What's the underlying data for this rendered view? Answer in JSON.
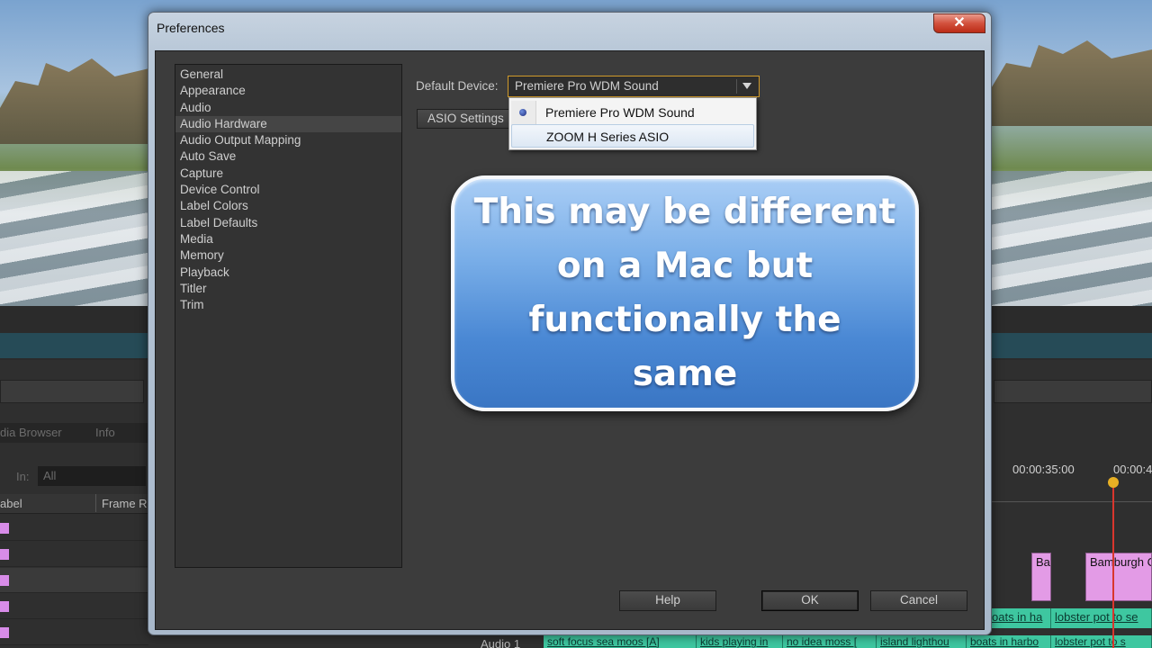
{
  "background_app": {
    "panel_tabs": [
      "dia Browser",
      "Info"
    ],
    "in_label": "In:",
    "in_value": "All",
    "column_headers": [
      "abel",
      "Frame R"
    ],
    "timecodes": [
      "00:00:35:00",
      "00:00:4"
    ],
    "video_clips": [
      "Ba",
      "Bamburgh C"
    ],
    "audio_track_label": "Audio 1",
    "audio_clips_row1": [
      "oats in ha",
      "lobster pot to se"
    ],
    "audio_clips_row2": [
      "soft focus sea moos [A]",
      "kids playing in",
      "no idea moss [",
      "island lighthou",
      "boats in harbo",
      "lobster pot to s"
    ]
  },
  "dialog": {
    "title": "Preferences",
    "close_label": "✕",
    "sidebar": {
      "items": [
        {
          "label": "General",
          "selected": false
        },
        {
          "label": "Appearance",
          "selected": false
        },
        {
          "label": "Audio",
          "selected": false
        },
        {
          "label": "Audio Hardware",
          "selected": true
        },
        {
          "label": "Audio Output Mapping",
          "selected": false
        },
        {
          "label": "Auto Save",
          "selected": false
        },
        {
          "label": "Capture",
          "selected": false
        },
        {
          "label": "Device Control",
          "selected": false
        },
        {
          "label": "Label Colors",
          "selected": false
        },
        {
          "label": "Label Defaults",
          "selected": false
        },
        {
          "label": "Media",
          "selected": false
        },
        {
          "label": "Memory",
          "selected": false
        },
        {
          "label": "Playback",
          "selected": false
        },
        {
          "label": "Titler",
          "selected": false
        },
        {
          "label": "Trim",
          "selected": false
        }
      ]
    },
    "default_device": {
      "label": "Default Device:",
      "selected_value": "Premiere Pro WDM Sound",
      "options": [
        {
          "label": "Premiere Pro WDM Sound",
          "checked": true
        },
        {
          "label": "ZOOM H Series ASIO",
          "checked": false,
          "hovered": true
        }
      ]
    },
    "asio_settings_label": "ASIO Settings",
    "buttons": {
      "help": "Help",
      "ok": "OK",
      "cancel": "Cancel"
    }
  },
  "callout": {
    "text": "This may be different on a Mac but functionally the same"
  },
  "colors": {
    "accent_border": "#d09a2a",
    "callout_blue": "#4a88d4",
    "dialog_bg": "#3c3c3c"
  }
}
